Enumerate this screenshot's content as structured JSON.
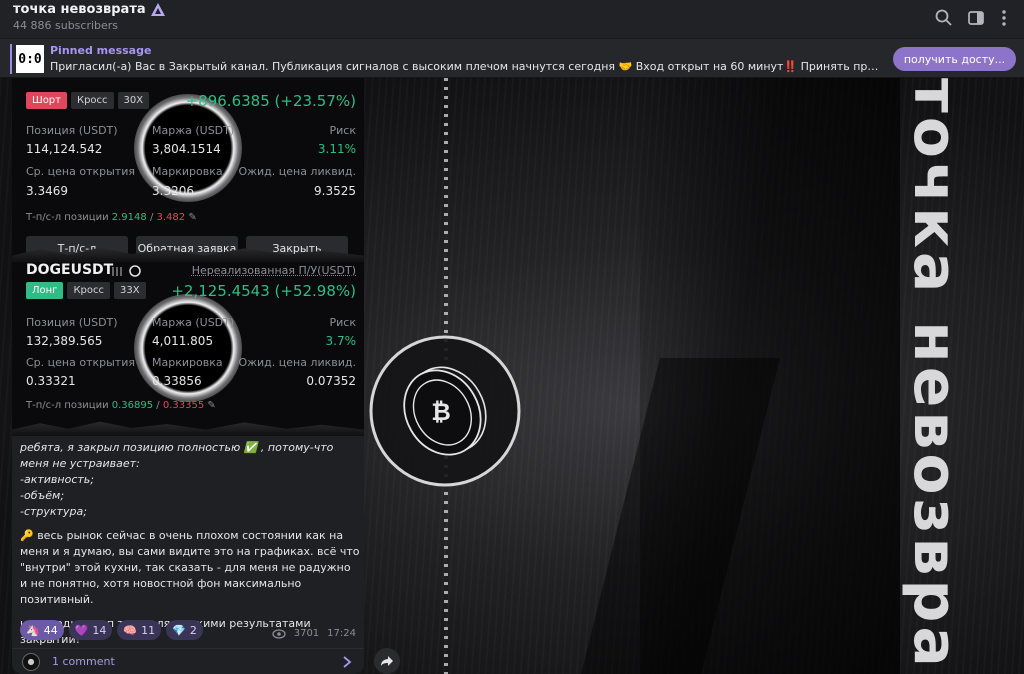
{
  "header": {
    "title": "точка невозврата",
    "subscribers": "44 886 subscribers",
    "icons": [
      "search-icon",
      "sidebar-toggle-icon",
      "more-vertical-icon"
    ]
  },
  "pinned": {
    "label": "Pinned message",
    "thumb_text": "0:0",
    "text": "Пригласил(-а) Вас в Закрытый канал.  Публикация сигналов с высоким плечом начнутся сегодня 🤝  Вход открыт на 60 минут‼️  Принять приглашение...",
    "button": "получить досту..."
  },
  "background": {
    "vertical_text": "точка невозвра"
  },
  "trade_short": {
    "tags": [
      "Шорт",
      "Кросс",
      "30X"
    ],
    "pnl": "+896.6385 (+23.57%)",
    "position_label": "Позиция (USDT)",
    "position_value": "114,124.542",
    "margin_label": "Маржа (USDT)",
    "margin_value": "3,804.1514",
    "risk_label": "Риск",
    "risk_value": "3.11%",
    "entry_label": "Ср. цена открытия",
    "entry_value": "3.3469",
    "mark_label": "Маркировка",
    "mark_value": "3.3206",
    "liq_label": "Ожид. цена ликвид.",
    "liq_value": "9.3525",
    "tpsl_label": "Т-п/с-л позиции",
    "tp_value": "2.9148",
    "sl_value": "3.482",
    "actions": [
      "Т-п/с-л",
      "Обратная заявка",
      "Закрыть"
    ]
  },
  "trade_long": {
    "symbol": "DOGEUSDT",
    "unrealized_label": "Нереализованная П/У(USDT)",
    "tags": [
      "Лонг",
      "Кросс",
      "33X"
    ],
    "pnl": "+2,125.4543 (+52.98%)",
    "position_label": "Позиция (USDT)",
    "position_value": "132,389.565",
    "margin_label": "Маржа (USDT)",
    "margin_value": "4,011.805",
    "risk_label": "Риск",
    "risk_value": "3.7%",
    "entry_label": "Ср. цена открытия",
    "entry_value": "0.33321",
    "mark_label": "Маркировка",
    "mark_value": "0.33856",
    "liq_label": "Ожид. цена ликвид.",
    "liq_value": "0.07352",
    "tpsl_label": "Т-п/с-л позиции",
    "tp_value": "0.36895",
    "sl_value": "0.33355"
  },
  "caption": {
    "line1": "ребята, я закрыл позицию полностью ✅ , потому-что меня не устраивает:",
    "line2": "-активность;",
    "line3": "-объём;",
    "line4": "-структура;",
    "para2": "🔑 весь рынок сейчас в очень плохом состоянии как на меня и я думаю, вы сами видите это на графиках. всё что \"внутри\" этой кухни, так сказать - для меня не радужно и не понятно, хотя новостной фон максимально позитивный.",
    "para3": "на сегодня стоп торговля с такими результатами закрытий!"
  },
  "reactions": [
    {
      "emoji": "🦄",
      "count": "44"
    },
    {
      "emoji": "💜",
      "count": "14"
    },
    {
      "emoji": "🧠",
      "count": "11"
    },
    {
      "emoji": "💎",
      "count": "2"
    }
  ],
  "meta": {
    "views": "3701",
    "time": "17:24"
  },
  "comments": {
    "label": "1 comment"
  },
  "colors": {
    "accent": "#8e74c8",
    "profit": "#2fbd85",
    "loss": "#e0475c"
  }
}
